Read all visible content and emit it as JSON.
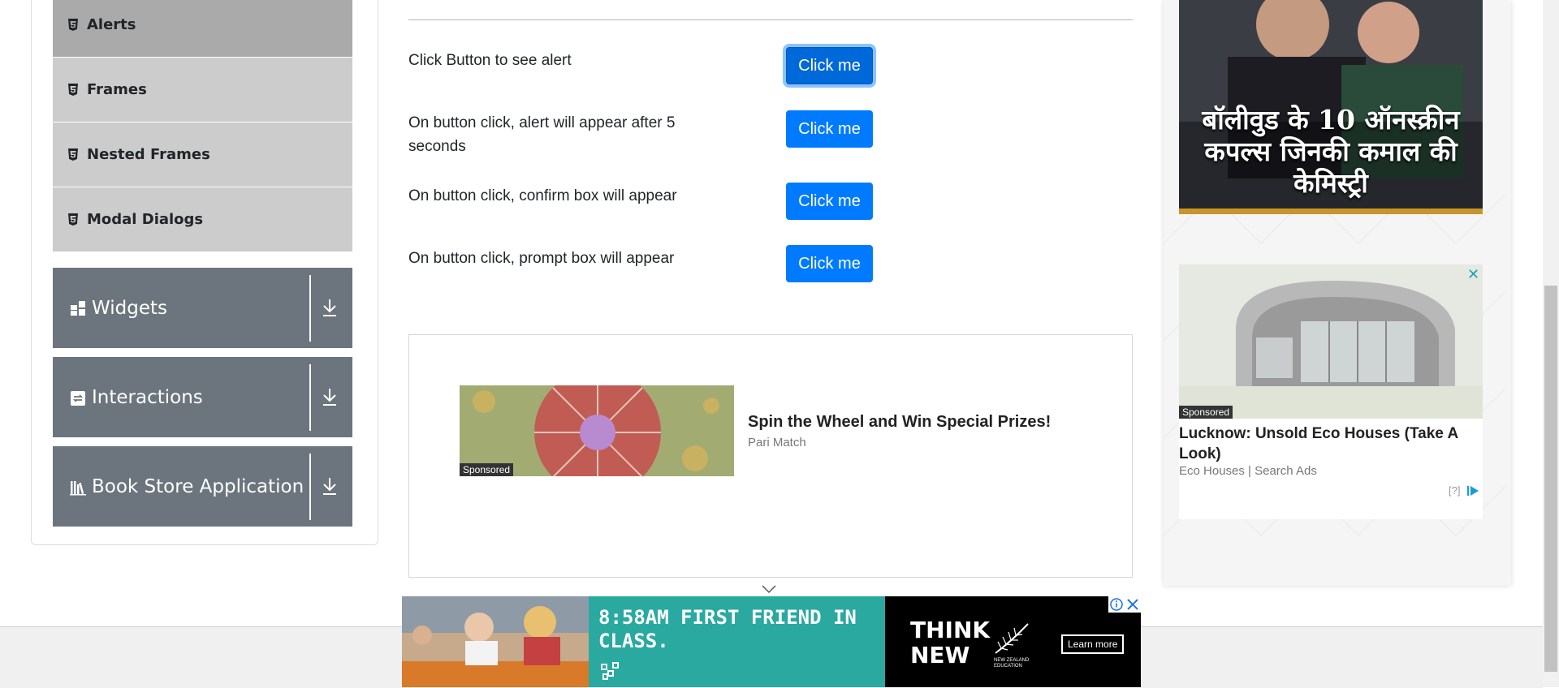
{
  "sidebar": {
    "sub_items": [
      {
        "label": "Alerts",
        "active": true
      },
      {
        "label": "Frames",
        "active": false
      },
      {
        "label": "Nested Frames",
        "active": false
      },
      {
        "label": "Modal Dialogs",
        "active": false
      }
    ],
    "groups": [
      {
        "label": "Widgets",
        "icon": "widgets-grid-icon"
      },
      {
        "label": "Interactions",
        "icon": "interactions-sync-icon"
      },
      {
        "label": "Book Store Application",
        "icon": "books-icon"
      }
    ]
  },
  "main": {
    "rows": [
      {
        "label": "Click Button to see alert",
        "button": "Click me"
      },
      {
        "label": "On button click, alert will appear after 5 seconds",
        "button": "Click me"
      },
      {
        "label": "On button click, confirm box will appear",
        "button": "Click me"
      },
      {
        "label": "On button click, prompt box will appear",
        "button": "Click me"
      }
    ]
  },
  "native_ad": {
    "sponsored": "Sponsored",
    "title": "Spin the Wheel and Win Special Prizes!",
    "source": "Pari Match"
  },
  "bottom_ad": {
    "headline": "8:58AM FIRST FRIEND IN CLASS.",
    "brand": "THINK NEW",
    "org": "NEW ZEALAND EDUCATION",
    "cta": "Learn more"
  },
  "right_ads": {
    "bollywood_text": "बॉलीवुड के 10 ऑनस्क्रीन कपल्स जिनकी कमाल की केमिस्ट्री",
    "eco": {
      "sponsored": "Sponsored",
      "title": "Lucknow: Unsold Eco Houses (Take A Look)",
      "source": "Eco Houses | Search Ads",
      "info": "[?]",
      "close": "✕"
    }
  },
  "colors": {
    "primary_button": "#007bff",
    "sidebar_group": "#6c757d",
    "sidebar_item": "#cccccc",
    "sidebar_item_active": "#aaaaaa",
    "ad_teal": "#2aa9a0"
  }
}
